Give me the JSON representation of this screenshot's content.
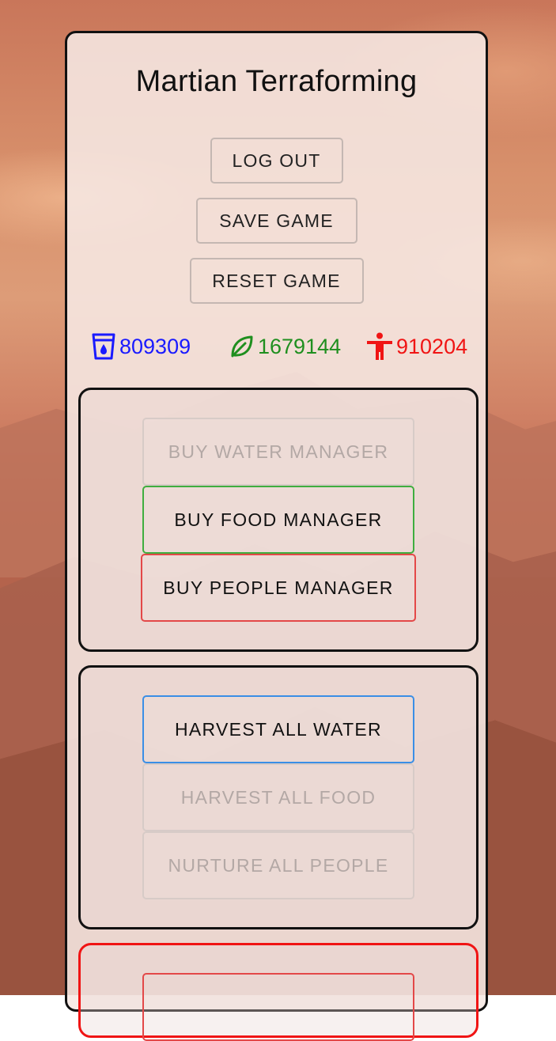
{
  "app": {
    "title": "Martian Terraforming"
  },
  "menu": {
    "logout_label": "LOG OUT",
    "save_label": "SAVE GAME",
    "reset_label": "RESET GAME"
  },
  "resources": {
    "water": {
      "icon": "water-glass-icon",
      "value": "809309",
      "color": "#1a1aff"
    },
    "food": {
      "icon": "leaf-icon",
      "value": "1679144",
      "color": "#1f8f1f"
    },
    "people": {
      "icon": "person-icon",
      "value": "910204",
      "color": "#f01414"
    }
  },
  "managers": {
    "water_label": "BUY WATER MANAGER",
    "water_enabled": false,
    "food_label": "BUY FOOD MANAGER",
    "food_enabled": true,
    "people_label": "BUY PEOPLE MANAGER",
    "people_enabled": true
  },
  "harvest": {
    "water_label": "HARVEST ALL WATER",
    "water_enabled": true,
    "food_label": "HARVEST ALL FOOD",
    "food_enabled": false,
    "people_label": "NURTURE ALL PEOPLE",
    "people_enabled": false
  },
  "colors": {
    "frame": "#111111",
    "danger": "#f01414"
  }
}
